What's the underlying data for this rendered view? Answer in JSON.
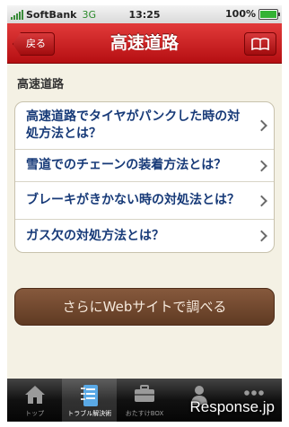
{
  "status_bar": {
    "carrier": "SoftBank",
    "network": "3G",
    "time": "13:25",
    "battery": "100%",
    "battery_level": 1.0
  },
  "nav": {
    "back_label": "戻る",
    "title": "高速道路",
    "book_icon": "book-icon"
  },
  "section_title": "高速道路",
  "items": [
    {
      "label": "高速道路でタイヤがパンクした時の対処方法とは？"
    },
    {
      "label": "雪道でのチェーンの装着方法とは？"
    },
    {
      "label": "ブレーキがきかない時の対処法とは？"
    },
    {
      "label": "ガス欠の対処方法とは？"
    }
  ],
  "cta_label": "さらにWebサイトで調べる",
  "tabs": [
    {
      "label": "トップ",
      "icon": "home-icon",
      "active": false
    },
    {
      "label": "トラブル解決術",
      "icon": "notebook-icon",
      "active": true
    },
    {
      "label": "おたすけBOX",
      "icon": "toolbox-icon",
      "active": false
    },
    {
      "label": "",
      "icon": "person-icon",
      "active": false
    },
    {
      "label": "",
      "icon": "more-icon",
      "active": false
    }
  ],
  "watermark": "Response.jp",
  "colors": {
    "navbar": "#c41c1f",
    "button": "#6e462c",
    "background": "#f4f1e4",
    "link_text": "#173a78"
  }
}
